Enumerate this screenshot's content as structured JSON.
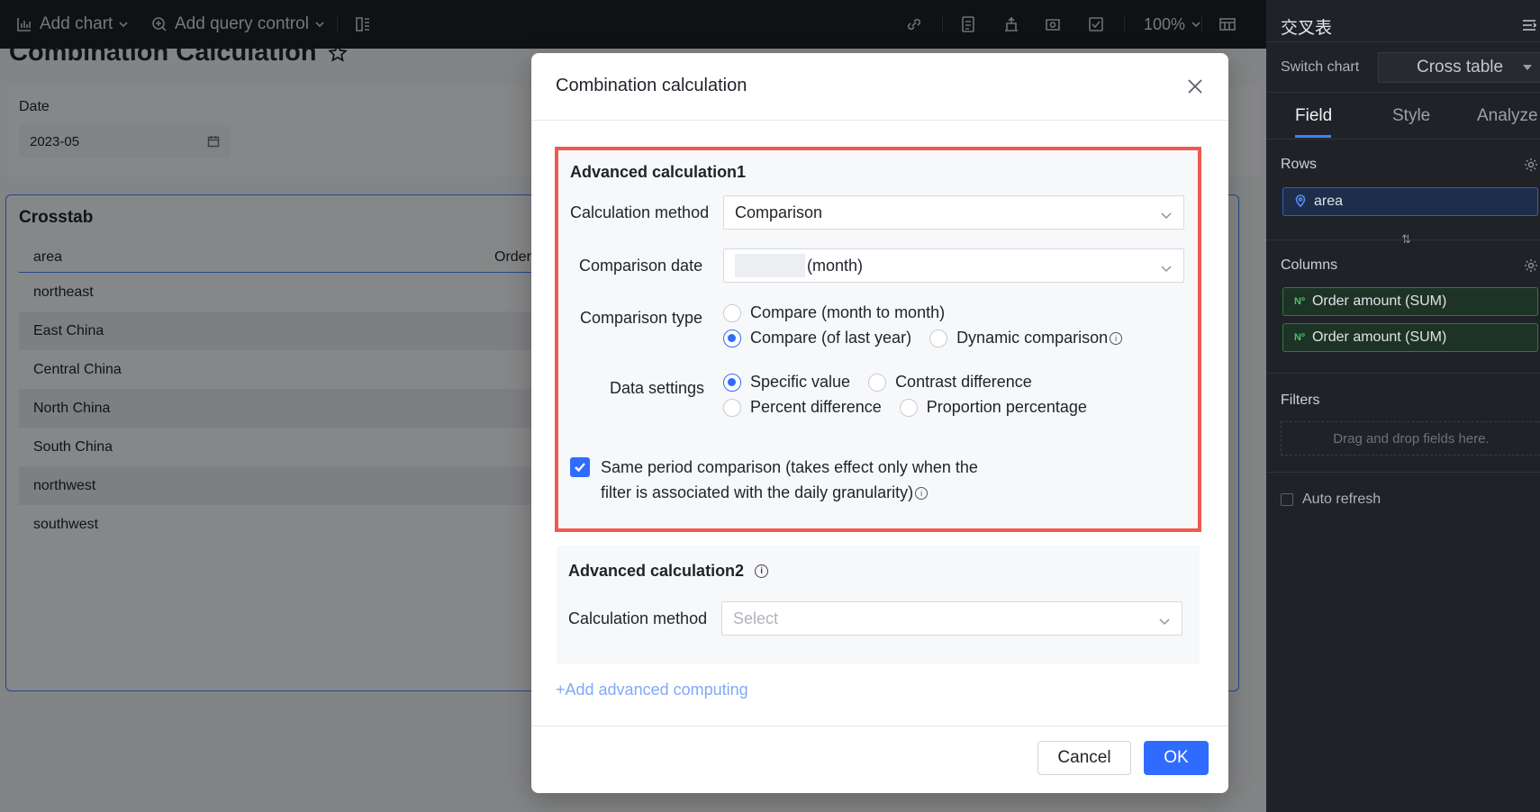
{
  "toolbar": {
    "add_chart": "Add chart",
    "add_query_control": "Add query control",
    "zoom": "100%"
  },
  "page": {
    "title": "Combination Calculation",
    "filter": {
      "label": "Date",
      "value": "2023-05"
    },
    "crosstab": {
      "title": "Crosstab",
      "columns": [
        "area",
        "Order a"
      ],
      "rows": [
        "northeast",
        "East China",
        "Central China",
        "North China",
        "South China",
        "northwest",
        "southwest"
      ]
    }
  },
  "panel": {
    "title": "交叉表",
    "switch_chart_label": "Switch chart",
    "switch_chart_value": "Cross table",
    "tabs": [
      "Field",
      "Style",
      "Analyze"
    ],
    "rows_label": "Rows",
    "rows_field": "area",
    "columns_label": "Columns",
    "column_fields": [
      "Order amount (SUM)",
      "Order amount (SUM)"
    ],
    "measure_badge": "Nº",
    "filters_label": "Filters",
    "filters_placeholder": "Drag and drop fields here.",
    "auto_refresh": "Auto refresh"
  },
  "modal": {
    "title": "Combination calculation",
    "calc1": {
      "title": "Advanced calculation1",
      "method_label": "Calculation method",
      "method_value": "Comparison",
      "date_label": "Comparison date",
      "date_value": "(month)",
      "type_label": "Comparison type",
      "type_options": [
        "Compare (month to month)",
        "Compare (of last year)",
        "Dynamic comparison"
      ],
      "type_selected": "Compare (of last year)",
      "data_label": "Data settings",
      "data_options": [
        "Specific value",
        "Contrast difference",
        "Percent difference",
        "Proportion percentage"
      ],
      "data_selected": "Specific value",
      "same_period_line1": "Same period comparison (takes effect only when the",
      "same_period_line2": "filter is associated with the daily granularity)",
      "same_period_checked": true
    },
    "calc2": {
      "title": "Advanced calculation2",
      "method_label": "Calculation method",
      "method_placeholder": "Select"
    },
    "add_link": "+Add advanced computing",
    "cancel": "Cancel",
    "ok": "OK"
  }
}
